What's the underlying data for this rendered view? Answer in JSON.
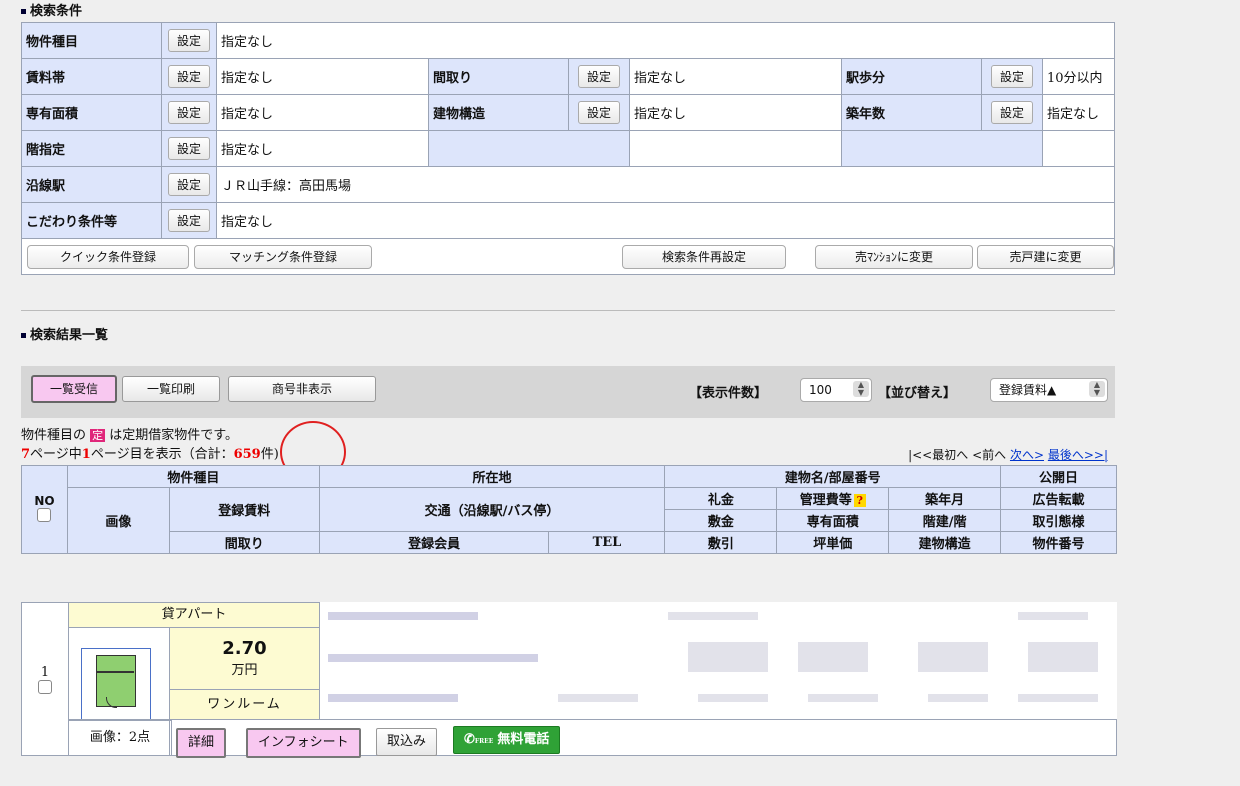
{
  "search_conditions": {
    "title": "検索条件",
    "set_label": "設定",
    "rows": [
      [
        {
          "label": "物件種目",
          "value": "指定なし"
        }
      ],
      [
        {
          "label": "賃料帯",
          "value": "指定なし"
        },
        {
          "label": "間取り",
          "value": "指定なし"
        },
        {
          "label": "駅歩分",
          "value": "10分以内"
        }
      ],
      [
        {
          "label": "専有面積",
          "value": "指定なし"
        },
        {
          "label": "建物構造",
          "value": "指定なし"
        },
        {
          "label": "築年数",
          "value": "指定なし"
        }
      ],
      [
        {
          "label": "階指定",
          "value": "指定なし"
        }
      ],
      [
        {
          "label": "沿線駅",
          "value": "ＪＲ山手線：高田馬場"
        }
      ],
      [
        {
          "label": "こだわり条件等",
          "value": "指定なし"
        }
      ]
    ],
    "buttons": {
      "quick": "クイック条件登録",
      "matching": "マッチング条件登録",
      "reset": "検索条件再設定",
      "to_mansion": "売ﾏﾝｼｮﾝに変更",
      "to_house": "売戸建に変更"
    }
  },
  "results": {
    "title": "検索結果一覧",
    "toolbar": {
      "receive": "一覧受信",
      "print": "一覧印刷",
      "hide_name": "商号非表示",
      "display_count_label": "【表示件数】",
      "display_count_value": "100",
      "sort_label": "【並び替え】",
      "sort_value": "登録賃料▲"
    },
    "note_prefix": "物件種目の",
    "note_badge": "定",
    "note_suffix": "は定期借家物件です。",
    "paging": {
      "total_pages": "7",
      "page_text_a": "ページ中",
      "current_page": "1",
      "page_text_b": "ページ目を表示（合計：",
      "total_count": "659",
      "count_suffix": "件)"
    },
    "nav": {
      "first": "|<<最初へ",
      "prev": "<前へ",
      "next": "次へ>",
      "last": "最後へ>>|"
    },
    "headers": {
      "no": "NO",
      "kind": "物件種目",
      "address": "所在地",
      "building": "建物名/部屋番号",
      "pub_date": "公開日",
      "image": "画像",
      "rent": "登録賃料",
      "access": "交通（沿線駅/バス停）",
      "key_money": "礼金",
      "mgmt": "管理費等",
      "built": "築年月",
      "ad": "広告転載",
      "deposit": "敷金",
      "area": "専有面積",
      "floors": "階建/階",
      "trade": "取引態様",
      "layout": "間取り",
      "member": "登録会員",
      "tel": "TEL",
      "deduct": "敷引",
      "tsubo": "坪単価",
      "structure": "建物構造",
      "prop_no": "物件番号"
    },
    "record": {
      "no": "1",
      "kind": "貸アパート",
      "rent": "2.70",
      "rent_unit": "万円",
      "layout": "ワンルーム",
      "image_count": "画像：2点",
      "btn_detail": "詳細",
      "btn_infosheet": "インフォシート",
      "btn_import": "取込み",
      "btn_free_call": "無料電話",
      "free_label": "FREE"
    }
  }
}
